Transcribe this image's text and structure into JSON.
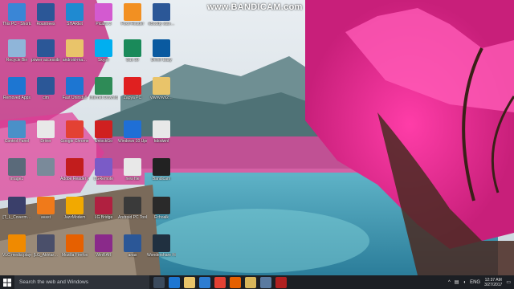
{
  "watermark": "www.BANDICAM.com",
  "desktop_icons": [
    {
      "label": "This PC - Shortcut",
      "icon": "computer-icon",
      "color": "#3a86d6"
    },
    {
      "label": "Recycle Bin",
      "icon": "recycle-bin-icon",
      "color": "#8fb5d9"
    },
    {
      "label": "Removed Apps",
      "icon": "edge-icon",
      "color": "#1d76d2"
    },
    {
      "label": "Control Panel",
      "icon": "control-panel-icon",
      "color": "#4a90c8"
    },
    {
      "label": "image1",
      "icon": "image-file-icon",
      "color": "#5a6a7a"
    },
    {
      "label": "[T_L_Coverm…",
      "icon": "video-file-icon",
      "color": "#3a3f6a"
    },
    {
      "label": "VLC media player",
      "icon": "vlc-icon",
      "color": "#f08a00"
    },
    {
      "label": "Rountrees",
      "icon": "word-doc-icon",
      "color": "#2b5797"
    },
    {
      "label": "power accessibility keys",
      "icon": "word-doc-icon",
      "color": "#2b5797"
    },
    {
      "label": "cim",
      "icon": "word-doc-icon",
      "color": "#2b5797"
    },
    {
      "label": "Driver",
      "icon": "document-icon",
      "color": "#e8e8e8"
    },
    {
      "label": "",
      "icon": "image-file-icon",
      "color": "#7a8a9a"
    },
    {
      "label": "avast",
      "icon": "avast-icon",
      "color": "#f07a1a"
    },
    {
      "label": "[LG_Akhtar…",
      "icon": "video-file-icon",
      "color": "#4a4f6a"
    },
    {
      "label": "SHAREit",
      "icon": "shareit-icon",
      "color": "#1f8ad1"
    },
    {
      "label": "android-ma…",
      "icon": "folder-icon",
      "color": "#e9c46a"
    },
    {
      "label": "Fast Uninstall",
      "icon": "edge-icon",
      "color": "#1d76d2"
    },
    {
      "label": "Google Chrome",
      "icon": "chrome-icon",
      "color": "#e34133"
    },
    {
      "label": "Adobe Reader XI",
      "icon": "acrobat-icon",
      "color": "#c21d1d"
    },
    {
      "label": "JazzModem",
      "icon": "jazz-icon",
      "color": "#f2a900"
    },
    {
      "label": "Mozilla Firefox",
      "icon": "firefox-icon",
      "color": "#e66000"
    },
    {
      "label": "Picasa 3",
      "icon": "picasa-icon",
      "color": "#d35ad0"
    },
    {
      "label": "Skype",
      "icon": "skype-icon",
      "color": "#00aff0"
    },
    {
      "label": "Internet Download…",
      "icon": "idm-icon",
      "color": "#2e8b57"
    },
    {
      "label": "UnlockGo",
      "icon": "unlock-icon",
      "color": "#d02020"
    },
    {
      "label": "LGRemote",
      "icon": "lg-remote-icon",
      "color": "#7a5bc7"
    },
    {
      "label": "LG Bridge",
      "icon": "lg-bridge-icon",
      "color": "#b02040"
    },
    {
      "label": "WinRAR",
      "icon": "winrar-icon",
      "color": "#8a2a8a"
    },
    {
      "label": "Foxit Reader",
      "icon": "pdf-icon",
      "color": "#f29022"
    },
    {
      "label": "Bus 30",
      "icon": "bus-icon",
      "color": "#1a8a5a"
    },
    {
      "label": "Zapya PC",
      "icon": "zapya-icon",
      "color": "#e02020"
    },
    {
      "label": "Windows 10 Update Assi…",
      "icon": "windows-icon",
      "color": "#1f6fd6"
    },
    {
      "label": "new file",
      "icon": "document-icon",
      "color": "#e8e8e8"
    },
    {
      "label": "Android PC Tool",
      "icon": "android-icon",
      "color": "#3a3a3a"
    },
    {
      "label": "anas",
      "icon": "word-doc-icon",
      "color": "#2b5797"
    },
    {
      "label": "eBuddy stan…",
      "icon": "word-doc-icon",
      "color": "#2b5797"
    },
    {
      "label": "Driver Easy",
      "icon": "driver-easy-icon",
      "color": "#0a5aa0"
    },
    {
      "label": "vvvvvvvv2…",
      "icon": "folder-icon",
      "color": "#e9c46a"
    },
    {
      "label": "kdodwnl",
      "icon": "document-icon",
      "color": "#e8e8e8"
    },
    {
      "label": "Bandicam",
      "icon": "bandicam-icon",
      "color": "#222222"
    },
    {
      "label": "Echoalk",
      "icon": "echo-icon",
      "color": "#2a2a2a"
    },
    {
      "label": "Wondershare Filmora",
      "icon": "filmora-icon",
      "color": "#203040"
    }
  ],
  "taskbar": {
    "search_placeholder": "Search the web and Windows",
    "apps": [
      {
        "name": "task-view",
        "color": "#3b4a5c"
      },
      {
        "name": "edge",
        "color": "#1d76d2"
      },
      {
        "name": "file-explorer",
        "color": "#e9c46a"
      },
      {
        "name": "store",
        "color": "#2d7dd2"
      },
      {
        "name": "chrome",
        "color": "#e34133"
      },
      {
        "name": "firefox",
        "color": "#e66000"
      },
      {
        "name": "folder",
        "color": "#d8b55a"
      },
      {
        "name": "media",
        "color": "#5a7aa0"
      },
      {
        "name": "bandicam",
        "color": "#b02020"
      }
    ],
    "language": "ENG",
    "time": "12:37 AM",
    "date": "3/27/2017"
  }
}
